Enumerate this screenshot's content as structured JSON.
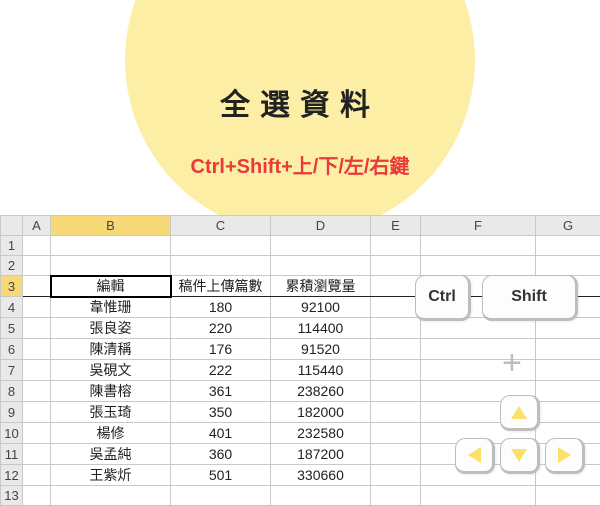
{
  "banner": {
    "title": "全選資料",
    "shortcut": "Ctrl+Shift+上/下/左/右鍵"
  },
  "columns": [
    "A",
    "B",
    "C",
    "D",
    "E",
    "F",
    "G"
  ],
  "rows": [
    "1",
    "2",
    "3",
    "4",
    "5",
    "6",
    "7",
    "8",
    "9",
    "10",
    "11",
    "12",
    "13"
  ],
  "headers": {
    "b": "編輯",
    "c": "稿件上傳篇數",
    "d": "累積瀏覽量"
  },
  "data": [
    {
      "b": "韋惟珊",
      "c": "180",
      "d": "92100"
    },
    {
      "b": "張良姿",
      "c": "220",
      "d": "114400"
    },
    {
      "b": "陳清稱",
      "c": "176",
      "d": "91520"
    },
    {
      "b": "吳硯文",
      "c": "222",
      "d": "115440"
    },
    {
      "b": "陳書榕",
      "c": "361",
      "d": "238260"
    },
    {
      "b": "張玉琦",
      "c": "350",
      "d": "182000"
    },
    {
      "b": "楊修",
      "c": "401",
      "d": "232580"
    },
    {
      "b": "吳孟純",
      "c": "360",
      "d": "187200"
    },
    {
      "b": "王紫炘",
      "c": "501",
      "d": "330660"
    }
  ],
  "keys": {
    "ctrl": "Ctrl",
    "shift": "Shift",
    "plus": "+"
  },
  "chart_data": {
    "type": "table",
    "title": "累積瀏覽量 vs 稿件上傳篇數",
    "columns": [
      "編輯",
      "稿件上傳篇數",
      "累積瀏覽量"
    ],
    "rows": [
      [
        "韋惟珊",
        180,
        92100
      ],
      [
        "張良姿",
        220,
        114400
      ],
      [
        "陳清稱",
        176,
        91520
      ],
      [
        "吳硯文",
        222,
        115440
      ],
      [
        "陳書榕",
        361,
        238260
      ],
      [
        "張玉琦",
        350,
        182000
      ],
      [
        "楊修",
        401,
        232580
      ],
      [
        "吳孟純",
        360,
        187200
      ],
      [
        "王紫炘",
        501,
        330660
      ]
    ]
  }
}
